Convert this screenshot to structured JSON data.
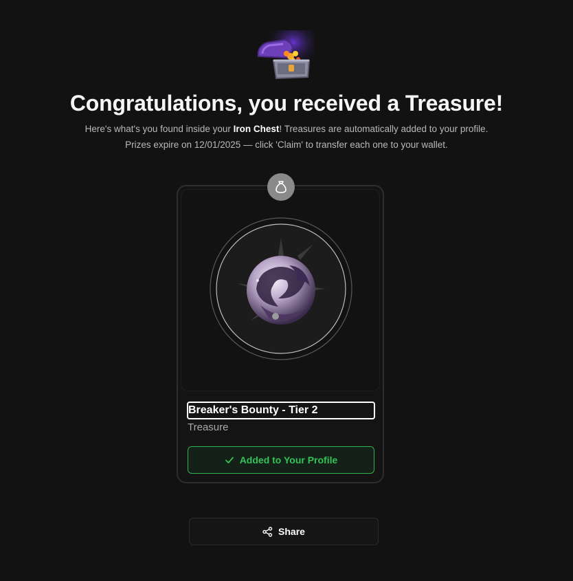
{
  "header": {
    "title": "Congratulations, you received a Treasure!",
    "subtitle_part1": "Here's what's you found inside your ",
    "chest_name": "Iron Chest",
    "subtitle_part2": "! Treasures are automatically added to your profile.",
    "subtitle_line2": "Prizes expire on 12/01/2025 — click 'Claim' to transfer each one to your wallet."
  },
  "icons": {
    "chest": "treasure-chest-icon",
    "badge": "money-bag-icon",
    "added": "checkmark-icon",
    "share": "share-icon"
  },
  "item": {
    "name": "Breaker's Bounty - Tier 2",
    "type": "Treasure"
  },
  "actions": {
    "added_label": "Added to Your Profile",
    "share_label": "Share"
  },
  "colors": {
    "background": "#121212",
    "success": "#36c257",
    "badge": "#8a8a8a"
  }
}
